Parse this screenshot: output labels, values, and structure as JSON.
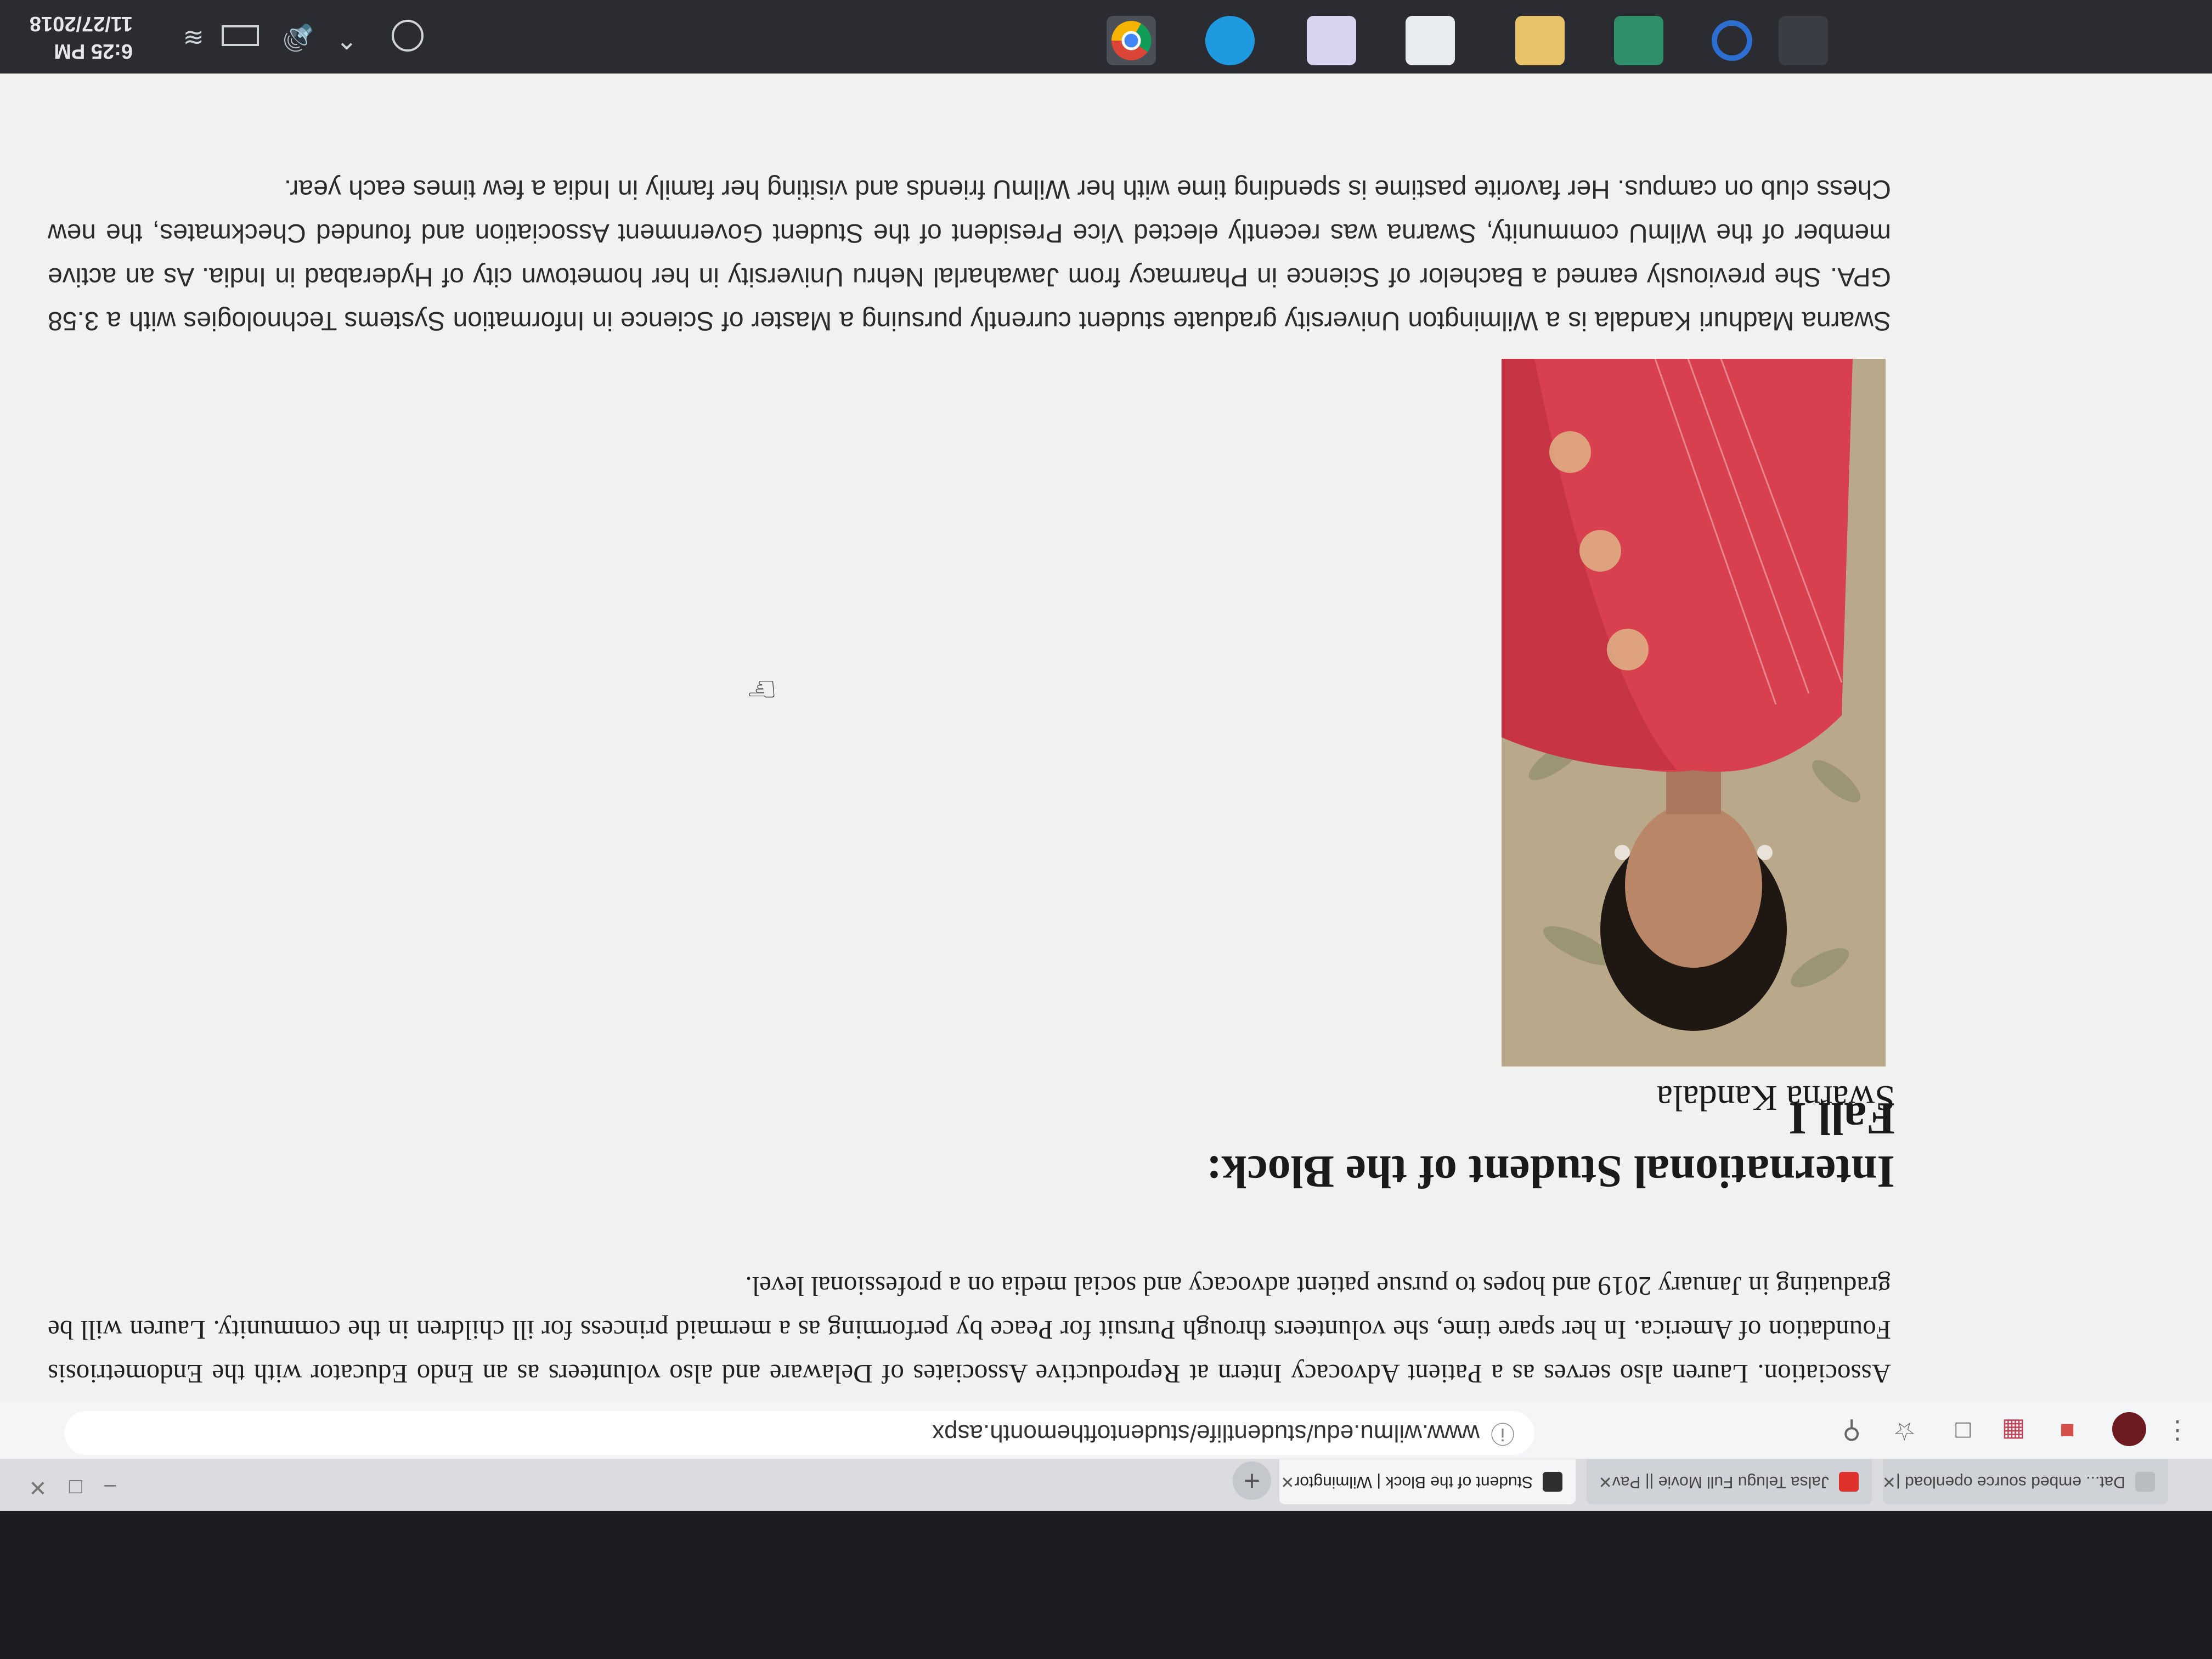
{
  "taskbar": {
    "time": "6:25 PM",
    "date": "11/27/2018",
    "tray_icons": [
      "people-icon",
      "chevron-up-icon",
      "volume-icon",
      "battery-icon",
      "wifi-icon"
    ],
    "apps": [
      "task-view-icon",
      "cortana-icon",
      "store-icon",
      "file-explorer-icon",
      "mail-icon",
      "onenote-icon",
      "skype-icon",
      "chrome-icon"
    ]
  },
  "browser": {
    "tabs": [
      {
        "label": "Dat... embed source openload |",
        "favicon": "page-icon"
      },
      {
        "label": "Jalsa Telugu Full Movie || Pav",
        "favicon": "youtube-icon"
      },
      {
        "label": "Student of the Block | Wilmingtor",
        "favicon": "wilmu-icon",
        "active": true
      }
    ],
    "url": "www.wilmu.edu/studentlife/studentofthemonth.aspx"
  },
  "page": {
    "prev_paragraph": "Association. Lauren also serves as a Patient Advocacy Intern at Reproductive Associates of Delaware and also volunteers as an Endo Educator with the Endometriosis Foundation of America. In her spare time, she volunteers through Pursuit for Peace by performing as a mermaid princess for ill children in the community. Lauren will be graduating in January 2019 and hopes to pursue patient advocacy and social media on a professional level.",
    "heading": "International Student of the Block: Fall I",
    "caption": "Swarna Kandala",
    "bio": "Swarna Madhuri Kandala is a Wilmington University graduate student currently pursuing a Master of Science in Information Systems Technologies with a 3.58 GPA. She previously earned a Bachelor of Science in Pharmacy from Jawaharlal Nehru University in her hometown city of Hyderabad in India. As an active member of the WilmU community, Swarna was recently elected Vice President of the Student Government Association and founded Checkmates, the new Chess club on campus. Her favorite pastime is spending time with her WilmU friends and visiting her family in India a few times each year."
  },
  "colors": {
    "saree": "#d8404f",
    "background_page": "#f1f1ef",
    "taskbar": "#2a2c31"
  }
}
